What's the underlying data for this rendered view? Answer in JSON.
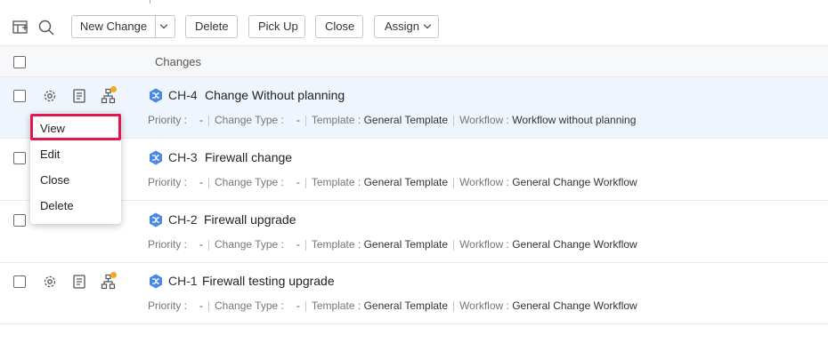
{
  "toolbar": {
    "new_change_label": "New Change",
    "delete_label": "Delete",
    "pick_up_label": "Pick Up",
    "close_label": "Close",
    "assign_label": "Assign"
  },
  "table": {
    "header_title": "Changes",
    "rows": [
      {
        "id": "CH-4",
        "subject": "Change Without planning",
        "priority_label": "Priority :",
        "priority": "-",
        "change_type_label": "Change Type :",
        "change_type": "-",
        "template_label": "Template :",
        "template": "General Template",
        "workflow_label": "Workflow :",
        "workflow": "Workflow without planning"
      },
      {
        "id": "CH-3",
        "subject": "Firewall change",
        "priority_label": "Priority :",
        "priority": "-",
        "change_type_label": "Change Type :",
        "change_type": "-",
        "template_label": "Template :",
        "template": "General Template",
        "workflow_label": "Workflow :",
        "workflow": "General Change Workflow"
      },
      {
        "id": "CH-2",
        "subject": "Firewall upgrade",
        "priority_label": "Priority :",
        "priority": "-",
        "change_type_label": "Change Type :",
        "change_type": "-",
        "template_label": "Template :",
        "template": "General Template",
        "workflow_label": "Workflow :",
        "workflow": "General Change Workflow"
      },
      {
        "id": "CH-1",
        "subject": "Firewall testing upgrade",
        "priority_label": "Priority :",
        "priority": "-",
        "change_type_label": "Change Type :",
        "change_type": "-",
        "template_label": "Template :",
        "template": "General Template",
        "workflow_label": "Workflow :",
        "workflow": "General Change Workflow"
      }
    ]
  },
  "context_menu": {
    "items": [
      "View",
      "Edit",
      "Close",
      "Delete"
    ],
    "focused_item": "View"
  },
  "icons": {
    "toolbar": [
      "table-settings-icon",
      "search-icon"
    ],
    "row_actions": [
      "gear-icon",
      "notes-icon",
      "workflow-icon"
    ],
    "change_type": "change-hexagon-icon"
  },
  "colors": {
    "highlight_row": "#eef5fc",
    "focus_border": "#e1174f",
    "change_icon": "#4a86e8",
    "workflow_badge": "#f4a623"
  }
}
